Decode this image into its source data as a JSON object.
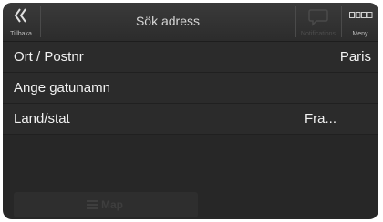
{
  "header": {
    "back_label": "Tillbaka",
    "title": "Sök adress",
    "notifications_label": "Notifications",
    "menu_label": "Meny"
  },
  "address_form": {
    "rows": [
      {
        "label": "Ort / Postnr",
        "value": "Paris"
      },
      {
        "label": "Ange gatunamn",
        "value": ""
      },
      {
        "label": "Land/stat",
        "value": "Fra..."
      }
    ]
  },
  "footer": {
    "map_button_label": "Map"
  },
  "icons": {
    "back": "double-chevron-left-icon",
    "notifications": "speech-bubble-icon",
    "menu": "grid-icon",
    "map": "list-icon"
  }
}
